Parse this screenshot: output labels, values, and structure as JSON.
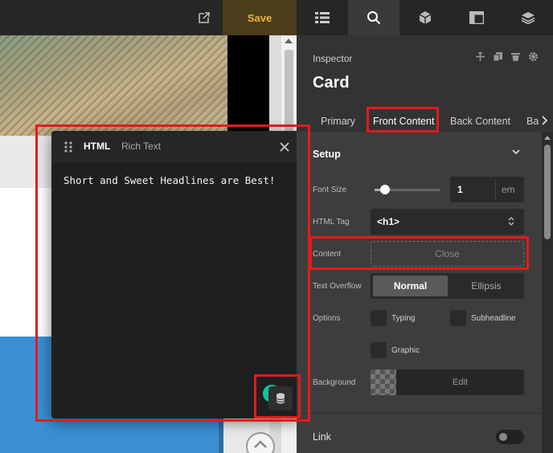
{
  "toolbar": {
    "save_label": "Save",
    "icons": [
      "external-link-icon",
      "list-icon",
      "search-icon",
      "cube-icon",
      "layout-icon",
      "layers-icon"
    ]
  },
  "popup": {
    "tabs": [
      "HTML",
      "Rich Text"
    ],
    "active_tab": "HTML",
    "content": "Short and Sweet Headlines are Best!"
  },
  "inspector": {
    "label": "Inspector",
    "title": "Card",
    "tabs": [
      {
        "label": "Primary"
      },
      {
        "label": "Front Content",
        "active": true
      },
      {
        "label": "Back Content"
      },
      {
        "label": "Ba"
      }
    ],
    "section": "Setup",
    "font_size": {
      "label": "Font Size",
      "value": "1",
      "unit": "em"
    },
    "html_tag": {
      "label": "HTML Tag",
      "value": "<h1>"
    },
    "content": {
      "label": "Content",
      "button": "Close"
    },
    "text_overflow": {
      "label": "Text Overflow",
      "options": [
        "Normal",
        "Ellipsis"
      ],
      "selected": "Normal"
    },
    "options": {
      "label": "Options",
      "items": [
        "Typing",
        "Subheadline",
        "Graphic"
      ]
    },
    "background": {
      "label": "Background",
      "button": "Edit"
    },
    "link": {
      "label": "Link"
    }
  },
  "colors": {
    "accent_save": "#e8b53f",
    "annotation_red": "#e31b1b",
    "panel_bg": "#3d3d3d",
    "grammarly_green": "#15c39a"
  }
}
